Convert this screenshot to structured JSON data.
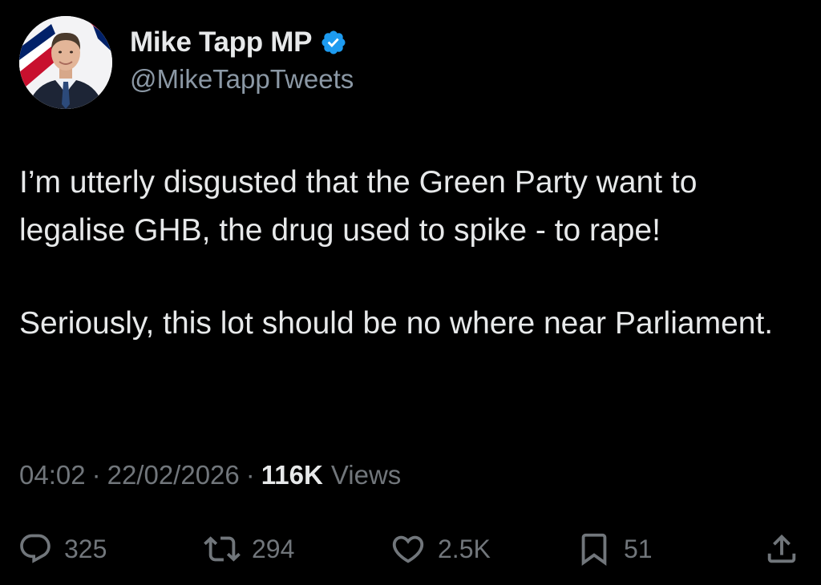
{
  "author": {
    "display_name": "Mike Tapp MP",
    "handle": "@MikeTappTweets",
    "verified": true,
    "avatar_icon": "profile-photo"
  },
  "tweet": {
    "paragraphs": [
      "I’m utterly disgusted that the Green Party want to legalise GHB, the drug used to spike - to rape!",
      "Seriously, this lot should be no where near Parliament."
    ],
    "time": "04:02",
    "separator": "·",
    "date": "22/02/2026",
    "views_count": "116K",
    "views_label": "Views"
  },
  "actions": {
    "replies": "325",
    "reposts": "294",
    "likes": "2.5K",
    "bookmarks": "51"
  },
  "colors": {
    "background": "#000000",
    "text": "#e7e9ea",
    "secondary": "#71767b",
    "verified": "#1d9bf0"
  }
}
